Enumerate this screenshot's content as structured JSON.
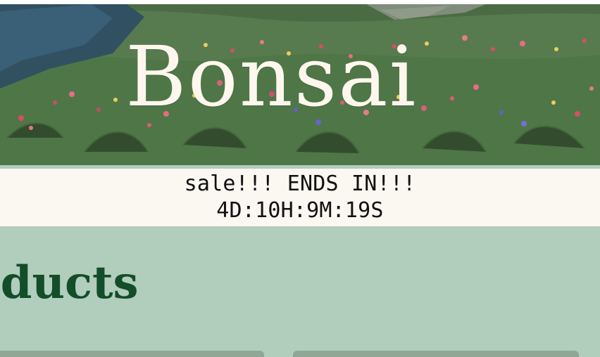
{
  "brand": {
    "name": "Bonsai"
  },
  "sale": {
    "line1": "sale!!! ENDS IN!!!",
    "line2": "4D:10H:9M:19S"
  },
  "products": {
    "title_visible": "oducts"
  },
  "colors": {
    "background": "#b1cdbb",
    "sale_background": "#fbf7f1",
    "title": "#134d29",
    "brand_text": "#fff7ee",
    "card_top": "#90a796"
  },
  "icons": {
    "hero": "painted-garden-meadow",
    "product_card_tops": "product-card-tops"
  }
}
